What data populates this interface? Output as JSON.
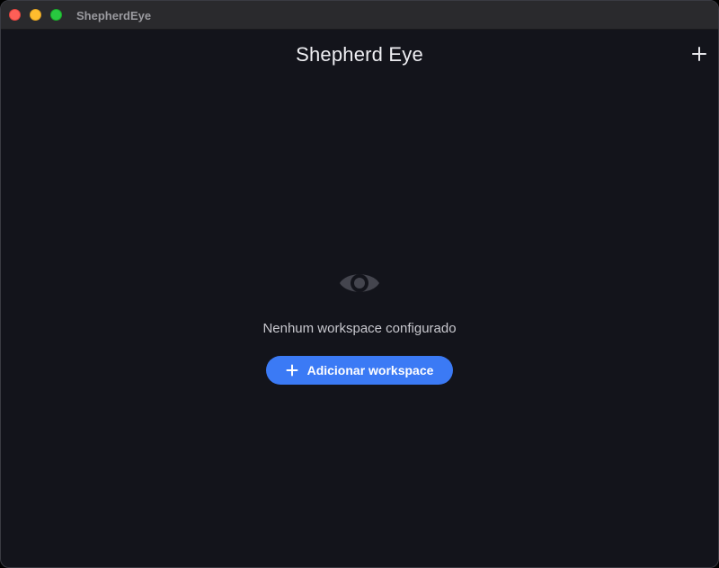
{
  "window": {
    "title": "ShepherdEye"
  },
  "header": {
    "title": "Shepherd Eye",
    "add_icon": "plus-icon"
  },
  "empty_state": {
    "icon": "eye-icon",
    "message": "Nenhum workspace configurado",
    "button_label": "Adicionar workspace",
    "button_icon": "plus-icon"
  },
  "colors": {
    "background": "#13141b",
    "accent": "#3b7af5",
    "titlebar": "#2a2a2d"
  }
}
